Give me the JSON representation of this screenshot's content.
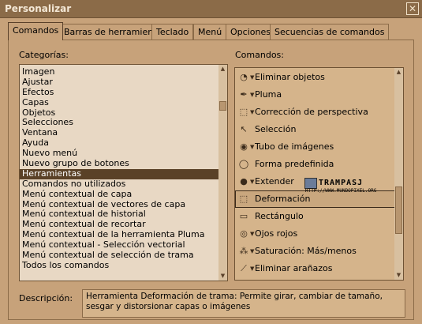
{
  "window": {
    "title": "Personalizar"
  },
  "tabs": [
    "Comandos",
    "Barras de herramientas",
    "Teclado",
    "Menú",
    "Opciones",
    "Secuencias de comandos"
  ],
  "categories": {
    "label": "Categorías:",
    "items": [
      "Imagen",
      "Ajustar",
      "Efectos",
      "Capas",
      "Objetos",
      "Selecciones",
      "Ventana",
      "Ayuda",
      "Nuevo menú",
      "Nuevo grupo de botones",
      "Herramientas",
      "Comandos no utilizados",
      "Menú contextual de capa",
      "Menú contextual de vectores de capa",
      "Menú contextual de historial",
      "Menú contextual de recortar",
      "Menú contextual de la herramienta Pluma",
      "Menú contextual - Selección vectorial",
      "Menú contextual de selección de trama",
      "Todos los comandos"
    ],
    "selected": "Herramientas"
  },
  "commands": {
    "label": "Comandos:",
    "items": [
      {
        "label": "Eliminar objetos",
        "icon": "object-remover-icon",
        "glyph": "◔",
        "dropdown": true
      },
      {
        "label": "Pluma",
        "icon": "pen-icon",
        "glyph": "✒",
        "dropdown": true
      },
      {
        "label": "Corrección de perspectiva",
        "icon": "perspective-correction-icon",
        "glyph": "⬚",
        "dropdown": true
      },
      {
        "label": "Selección",
        "icon": "pick-arrow-icon",
        "glyph": "↖",
        "dropdown": false
      },
      {
        "label": "Tubo de imágenes",
        "icon": "picture-tube-icon",
        "glyph": "◉",
        "dropdown": true
      },
      {
        "label": "Forma predefinida",
        "icon": "preset-shape-icon",
        "glyph": "◯",
        "dropdown": false
      },
      {
        "label": "Extender",
        "icon": "extend-icon",
        "glyph": "●",
        "dropdown": true
      },
      {
        "label": "Deformación",
        "icon": "deform-icon",
        "glyph": "⬚",
        "dropdown": false
      },
      {
        "label": "Rectángulo",
        "icon": "rectangle-icon",
        "glyph": "▭",
        "dropdown": false
      },
      {
        "label": "Ojos rojos",
        "icon": "red-eye-icon",
        "glyph": "◎",
        "dropdown": true
      },
      {
        "label": "Saturación: Más/menos",
        "icon": "saturation-icon",
        "glyph": "⁂",
        "dropdown": true
      },
      {
        "label": "Eliminar arañazos",
        "icon": "scratch-remover-icon",
        "glyph": "⟋",
        "dropdown": true
      }
    ],
    "selected": "Deformación"
  },
  "watermark": {
    "title": "TRAMPASJ",
    "url": "HTTP://WWW.MUNDOPIXEL.ORG"
  },
  "description": {
    "label": "Descripción:",
    "text": "Herramienta Deformación de trama: Permite girar, cambiar de tamaño, sesgar y distorsionar capas o imágenes"
  },
  "colors": {
    "background": "#c7a27a",
    "titlebar": "#8b6b48",
    "selection": "#5a4127",
    "list": "#e8d8c4",
    "commandList": "#d5b48b"
  }
}
